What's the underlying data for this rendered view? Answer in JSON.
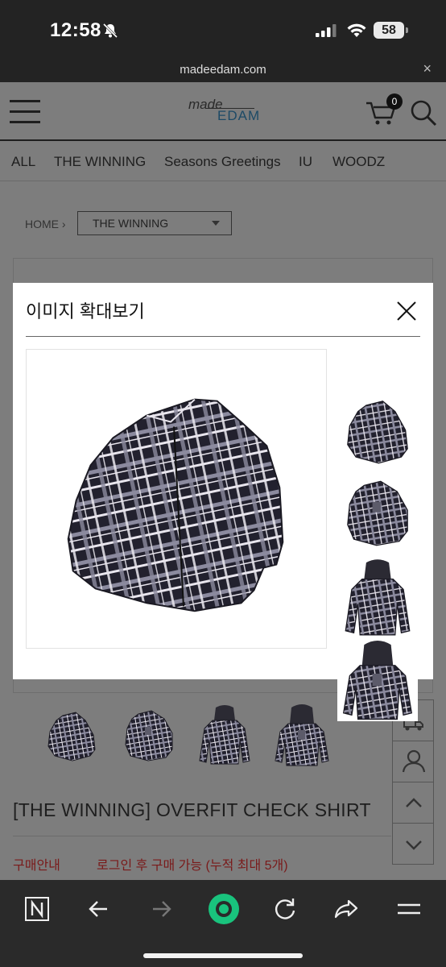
{
  "status": {
    "time": "12:58",
    "battery": "58"
  },
  "browser": {
    "url": "madeedam.com"
  },
  "header": {
    "logo_top": "made",
    "logo_bottom": "EDAM",
    "cart_count": "0"
  },
  "categories": [
    "ALL",
    "THE WINNING",
    "Seasons Greetings",
    "IU",
    "WOODZ"
  ],
  "breadcrumb": {
    "home": "HOME",
    "selected": "THE WINNING"
  },
  "product": {
    "title": "[THE WINNING] OVERFIT CHECK SHIRT",
    "purchase_label": "구매안내",
    "purchase_info": "로그인 후 구매 가능 (누적 최대 5개)"
  },
  "modal": {
    "title": "이미지 확대보기"
  },
  "colors": {
    "plaid_dark": "#22212e",
    "plaid_light": "#e9e6ee",
    "accent_green": "#19c37d"
  }
}
